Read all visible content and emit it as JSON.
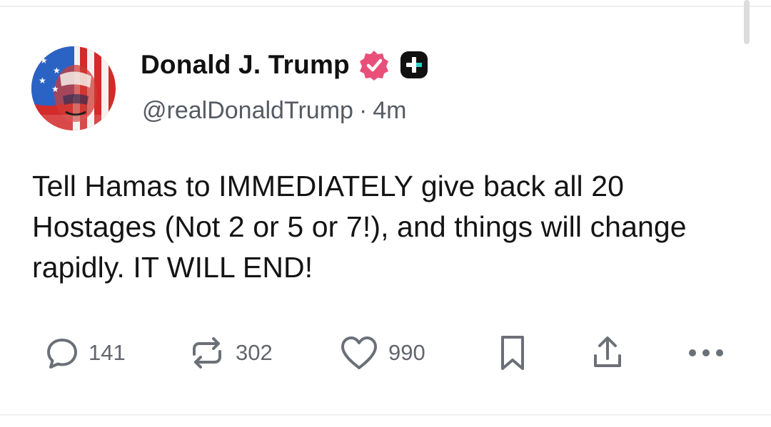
{
  "post": {
    "author": {
      "display_name": "Donald J. Trump",
      "handle": "@realDonaldTrump",
      "separator": "·",
      "time_ago": "4m"
    },
    "text": "Tell Hamas to IMMEDIATELY give back all 20 Hostages (Not 2 or 5 or 7!), and things will change rapidly. IT WILL END!",
    "stats": {
      "replies": "141",
      "reposts": "302",
      "likes": "990"
    }
  },
  "icons": {
    "verified": "verified-badge-icon",
    "plus": "plus-badge-icon",
    "reply": "reply-icon",
    "repost": "repost-icon",
    "like": "heart-icon",
    "bookmark": "bookmark-icon",
    "share": "share-icon",
    "more": "more-icon"
  },
  "colors": {
    "verified_badge": "#e8507a",
    "plus_badge": "#111111",
    "plus_accent": "#2bd3c7",
    "icon_gray": "#6b7078",
    "handle_gray": "#555b63"
  }
}
